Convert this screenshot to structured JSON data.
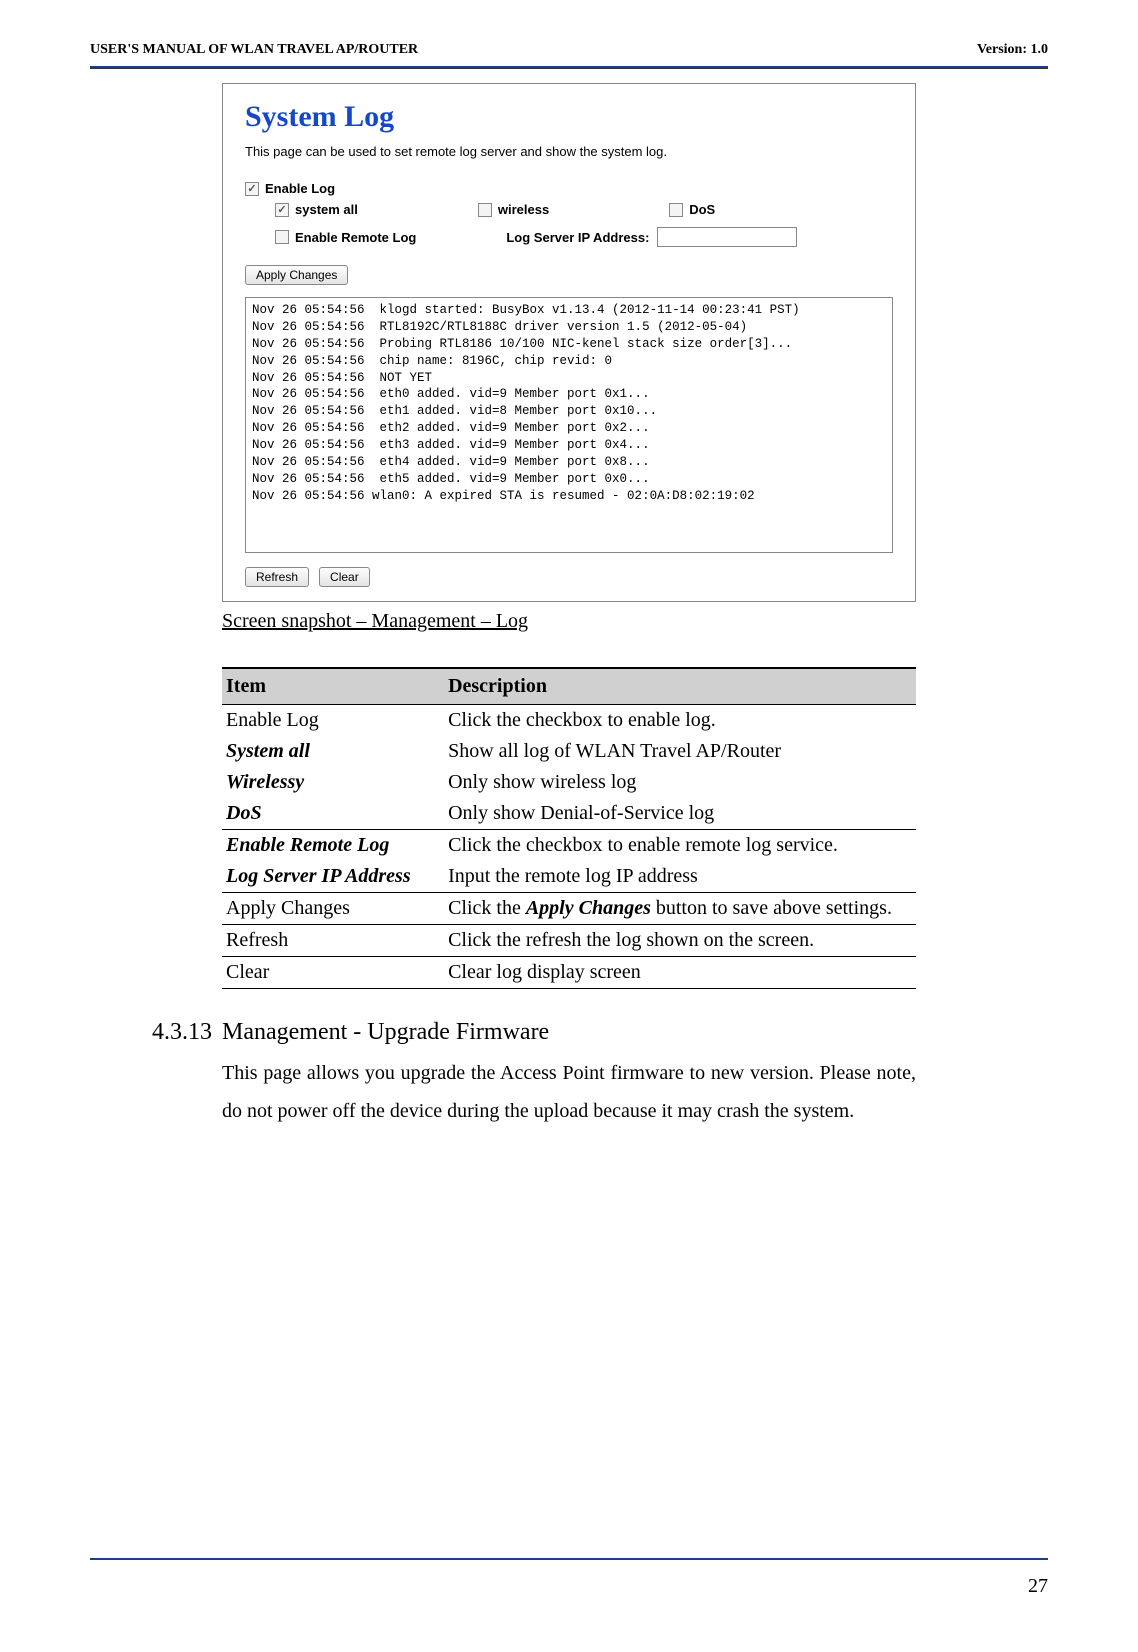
{
  "header": {
    "left": "USER'S MANUAL OF WLAN TRAVEL AP/ROUTER",
    "right": "Version: 1.0"
  },
  "screenshot": {
    "title": "System Log",
    "subtitle": "This page can be used to set remote log server and show the system log.",
    "enable_log_label": "Enable Log",
    "system_all_label": "system all",
    "wireless_label": "wireless",
    "dos_label": "DoS",
    "enable_remote_label": "Enable Remote Log",
    "log_server_ip_label": "Log Server IP Address:",
    "apply_button": "Apply Changes",
    "refresh_button": "Refresh",
    "clear_button": "Clear",
    "log_text": "Nov 26 05:54:56  klogd started: BusyBox v1.13.4 (2012-11-14 00:23:41 PST)\nNov 26 05:54:56  RTL8192C/RTL8188C driver version 1.5 (2012-05-04)\nNov 26 05:54:56  Probing RTL8186 10/100 NIC-kenel stack size order[3]...\nNov 26 05:54:56  chip name: 8196C, chip revid: 0\nNov 26 05:54:56  NOT YET\nNov 26 05:54:56  eth0 added. vid=9 Member port 0x1...\nNov 26 05:54:56  eth1 added. vid=8 Member port 0x10...\nNov 26 05:54:56  eth2 added. vid=9 Member port 0x2...\nNov 26 05:54:56  eth3 added. vid=9 Member port 0x4...\nNov 26 05:54:56  eth4 added. vid=9 Member port 0x8...\nNov 26 05:54:56  eth5 added. vid=9 Member port 0x0...\nNov 26 05:54:56 wlan0: A expired STA is resumed - 02:0A:D8:02:19:02"
  },
  "caption": "Screen snapshot – Management – Log",
  "table": {
    "head_item": "Item",
    "head_desc": "Description",
    "rows": [
      {
        "item_html": "Enable Log",
        "desc_html": "Click the checkbox to enable log.",
        "sep": false
      },
      {
        "item_html": "<span class='italic-bold'>System all</span>",
        "desc_html": "Show all log of WLAN Travel AP/Router",
        "sep": false
      },
      {
        "item_html": "<span class='italic-bold'>Wirelessy</span>",
        "desc_html": "Only show wireless log",
        "sep": false
      },
      {
        "item_html": "<span class='italic-bold'>DoS</span>",
        "desc_html": "Only show Denial-of-Service log",
        "sep": true
      },
      {
        "item_html": "<span class='italic-bold'>Enable Remote Log</span>",
        "desc_html": "Click the checkbox to enable remote log service.",
        "sep": false
      },
      {
        "item_html": "<span class='italic-bold'>Log Server IP Address</span>",
        "desc_html": "Input the remote log IP address",
        "sep": true
      },
      {
        "item_html": "Apply Changes",
        "desc_html": "Click the <span class='italic-bold'>Apply Changes</span> button to save above settings.",
        "sep": true
      },
      {
        "item_html": "Refresh",
        "desc_html": "Click the refresh the log shown on the screen.",
        "sep": true
      },
      {
        "item_html": "Clear",
        "desc_html": "Clear log display screen",
        "sep": true
      }
    ]
  },
  "section": {
    "number": "4.3.13",
    "title": "Management - Upgrade Firmware",
    "body": "This page allows you upgrade the Access Point firmware to new version. Please note, do not power off the device during the upload because it may crash the system."
  },
  "page_number": "27"
}
